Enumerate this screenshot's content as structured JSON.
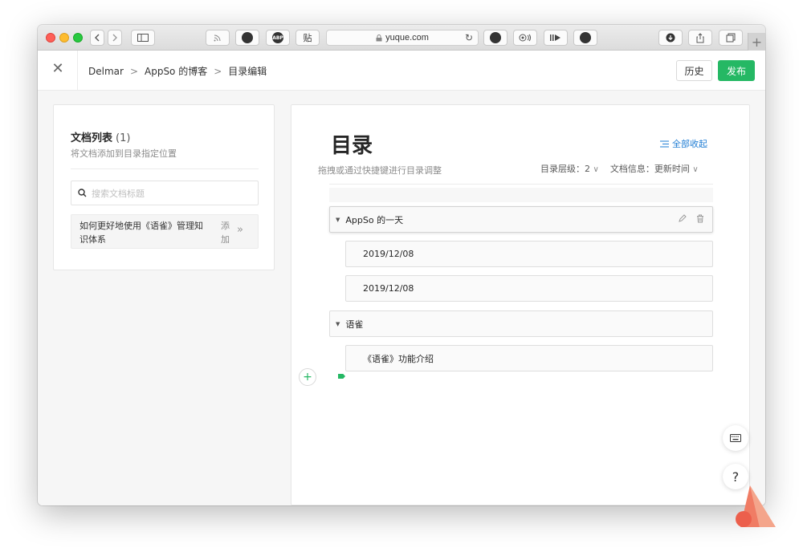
{
  "browser": {
    "url": "yuque.com",
    "reader_label": "ABP",
    "paste_label": "贴"
  },
  "header": {
    "breadcrumb": [
      "Delmar",
      "AppSo 的博客",
      "目录编辑"
    ],
    "history_label": "历史",
    "publish_label": "发布"
  },
  "doc_list": {
    "title": "文档列表",
    "count": "(1)",
    "subtitle": "将文档添加到目录指定位置",
    "search_placeholder": "搜索文档标题",
    "items": [
      {
        "title": "如何更好地使用《语雀》管理知识体系",
        "add_label": "添加"
      }
    ]
  },
  "toc": {
    "title": "目录",
    "collapse_all_label": "全部收起",
    "hint": "拖拽或通过快捷键进行目录调整",
    "level_label": "目录层级：2",
    "doc_info_label": "文档信息：更新时间",
    "items": [
      {
        "label": "AppSo 的一天",
        "level": 1
      },
      {
        "label": "2019/12/08",
        "level": 2
      },
      {
        "label": "2019/12/08",
        "level": 2
      },
      {
        "label": "语雀",
        "level": 1
      },
      {
        "label": "《语雀》功能介绍",
        "level": 2
      }
    ]
  },
  "floating": {
    "help_label": "?"
  },
  "colors": {
    "accent_green": "#25b864",
    "link_blue": "#1e7cd4"
  }
}
